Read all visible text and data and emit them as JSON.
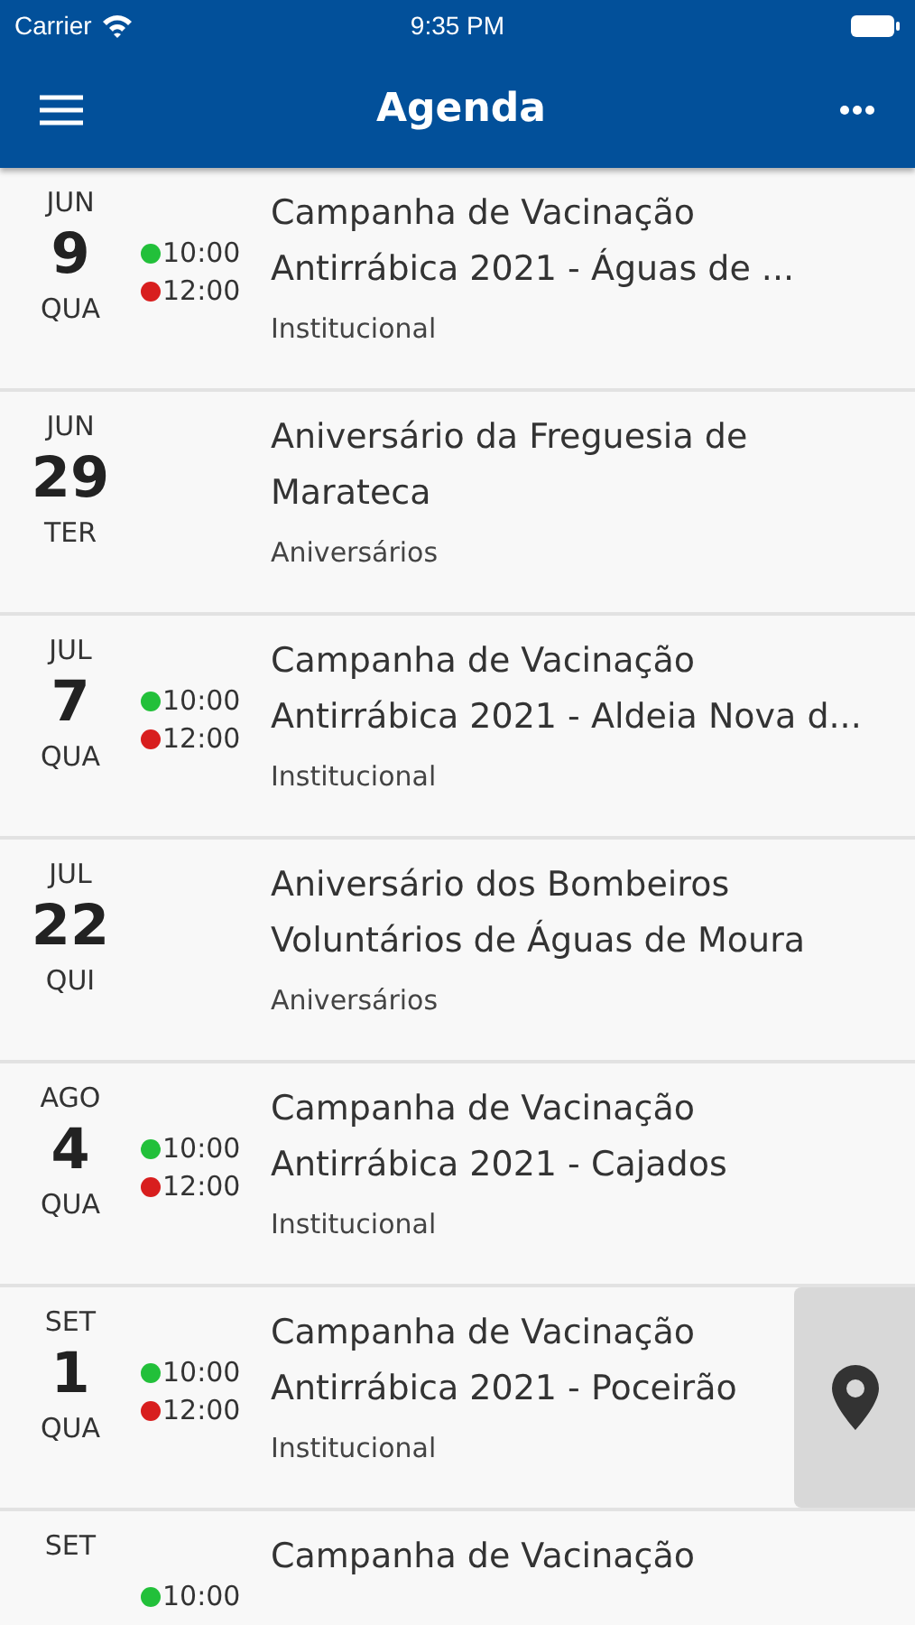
{
  "status_bar": {
    "carrier": "Carrier",
    "time": "9:35 PM"
  },
  "nav_bar": {
    "title": "Agenda"
  },
  "events": [
    {
      "month": "JUN",
      "day": "9",
      "weekday": "QUA",
      "times": [
        {
          "time": "10:00",
          "color": "#22c03a"
        },
        {
          "time": "12:00",
          "color": "#d81e1e"
        }
      ],
      "title_lines": [
        "Campanha de Vacinação",
        "Antirrábica 2021 - Águas de ..."
      ],
      "category": "Institucional",
      "location_button": false
    },
    {
      "month": "JUN",
      "day": "29",
      "weekday": "TER",
      "title_lines": [
        "Aniversário da Freguesia de",
        "Marateca"
      ],
      "category": "Aniversários",
      "location_button": false
    },
    {
      "month": "JUL",
      "day": "7",
      "weekday": "QUA",
      "times": [
        {
          "time": "10:00",
          "color": "#22c03a"
        },
        {
          "time": "12:00",
          "color": "#d81e1e"
        }
      ],
      "title_lines": [
        "Campanha de Vacinação",
        "Antirrábica 2021 - Aldeia Nova d..."
      ],
      "category": "Institucional",
      "location_button": false
    },
    {
      "month": "JUL",
      "day": "22",
      "weekday": "QUI",
      "title_lines": [
        "Aniversário dos Bombeiros",
        "Voluntários de Águas de Moura"
      ],
      "category": "Aniversários",
      "location_button": false
    },
    {
      "month": "AGO",
      "day": "4",
      "weekday": "QUA",
      "times": [
        {
          "time": "10:00",
          "color": "#22c03a"
        },
        {
          "time": "12:00",
          "color": "#d81e1e"
        }
      ],
      "title_lines": [
        "Campanha de Vacinação",
        "Antirrábica 2021 - Cajados"
      ],
      "category": "Institucional",
      "location_button": false
    },
    {
      "month": "SET",
      "day": "1",
      "weekday": "QUA",
      "times": [
        {
          "time": "10:00",
          "color": "#22c03a"
        },
        {
          "time": "12:00",
          "color": "#d81e1e"
        }
      ],
      "title_lines": [
        "Campanha de Vacinação",
        "Antirrábica 2021 - Poceirão"
      ],
      "category": "Institucional",
      "location_button": true
    },
    {
      "month": "SET",
      "times": [
        {
          "time": "10:00",
          "color": "#22c03a"
        }
      ],
      "title_lines": [
        "Campanha de Vacinação"
      ],
      "location_button": false
    }
  ]
}
